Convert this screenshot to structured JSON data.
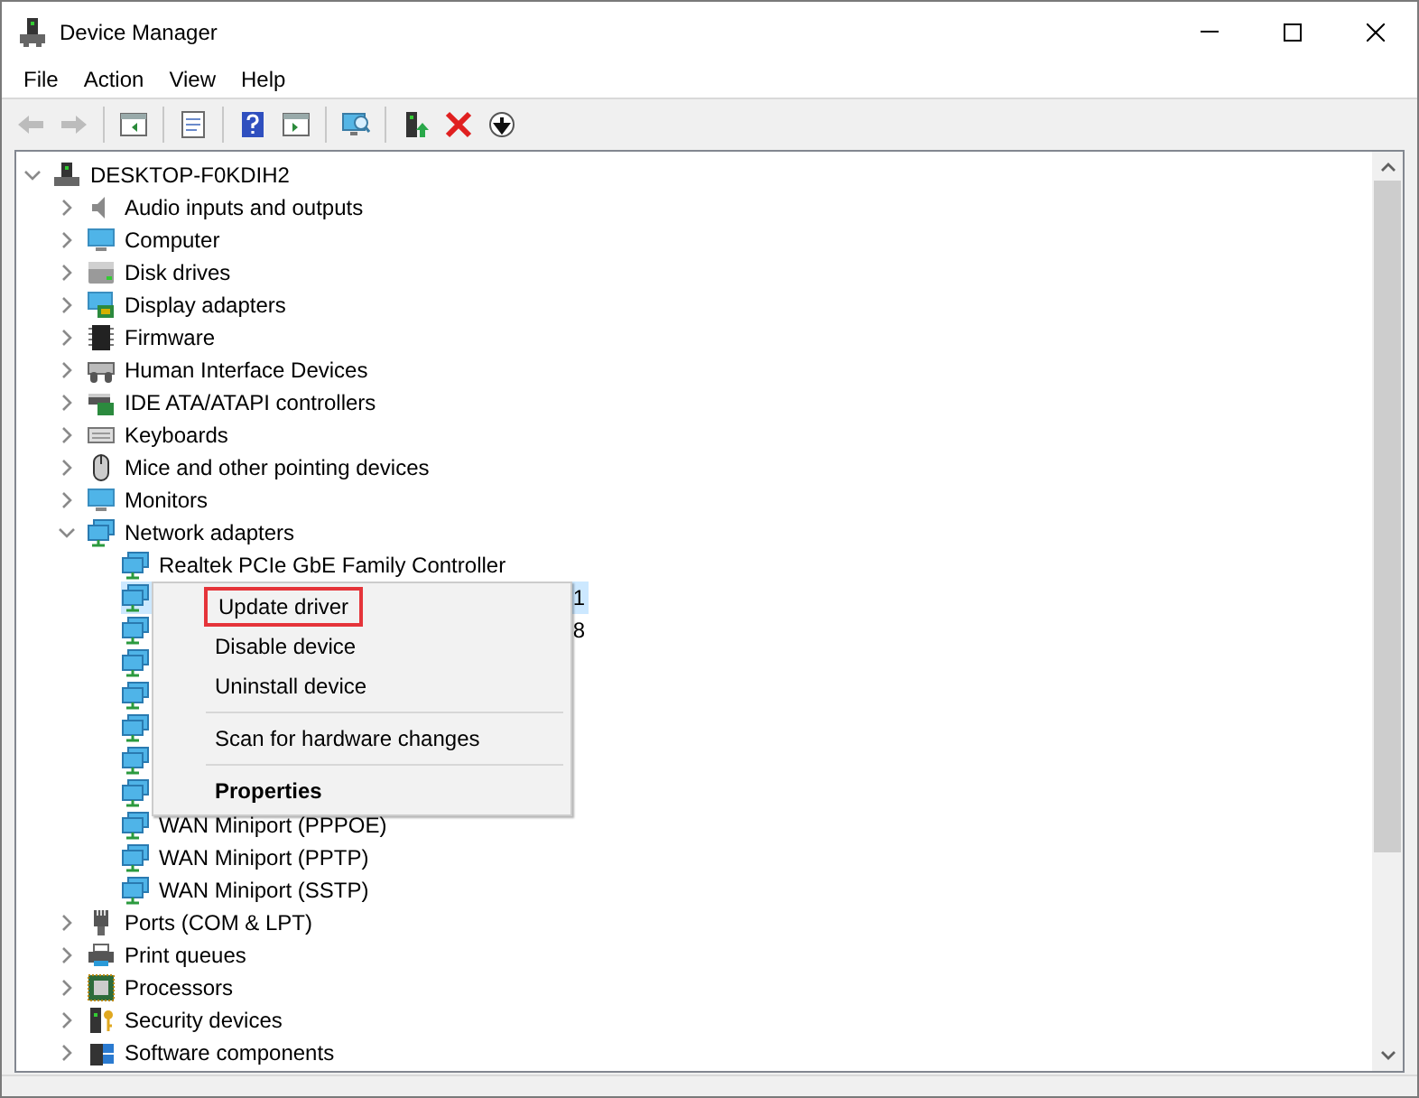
{
  "window": {
    "title": "Device Manager"
  },
  "menu": [
    "File",
    "Action",
    "View",
    "Help"
  ],
  "toolbar": [
    {
      "kind": "back",
      "disabled": true
    },
    {
      "kind": "forward",
      "disabled": true
    },
    {
      "kind": "separator"
    },
    {
      "kind": "tree",
      "disabled": false
    },
    {
      "kind": "separator"
    },
    {
      "kind": "properties",
      "disabled": false
    },
    {
      "kind": "separator"
    },
    {
      "kind": "help",
      "disabled": false
    },
    {
      "kind": "pane",
      "disabled": false
    },
    {
      "kind": "separator"
    },
    {
      "kind": "scan",
      "disabled": false
    },
    {
      "kind": "separator"
    },
    {
      "kind": "update",
      "disabled": false
    },
    {
      "kind": "uninstall",
      "disabled": false
    },
    {
      "kind": "disable",
      "disabled": false
    }
  ],
  "tree": {
    "label": "DESKTOP-F0KDIH2",
    "kind": "computer-root",
    "expanded": true,
    "children": [
      {
        "label": "Audio inputs and outputs",
        "kind": "audio",
        "expanded": false
      },
      {
        "label": "Computer",
        "kind": "monitor",
        "expanded": false
      },
      {
        "label": "Disk drives",
        "kind": "disk",
        "expanded": false
      },
      {
        "label": "Display adapters",
        "kind": "display",
        "expanded": false
      },
      {
        "label": "Firmware",
        "kind": "chip",
        "expanded": false
      },
      {
        "label": "Human Interface Devices",
        "kind": "hid",
        "expanded": false
      },
      {
        "label": "IDE ATA/ATAPI controllers",
        "kind": "ide",
        "expanded": false
      },
      {
        "label": "Keyboards",
        "kind": "keyboard",
        "expanded": false
      },
      {
        "label": "Mice and other pointing devices",
        "kind": "mouse",
        "expanded": false
      },
      {
        "label": "Monitors",
        "kind": "monitor",
        "expanded": false
      },
      {
        "label": "Network adapters",
        "kind": "network",
        "expanded": true,
        "children": [
          {
            "label": "Realtek PCIe GbE Family Controller",
            "kind": "network",
            "selected": false
          },
          {
            "label": "1",
            "kind": "network",
            "covered": true,
            "selected": true
          },
          {
            "label": "8",
            "kind": "network",
            "covered": true,
            "selected": false
          },
          {
            "kind": "network",
            "covered": true,
            "selected": false
          },
          {
            "kind": "network",
            "covered": true,
            "selected": false
          },
          {
            "kind": "network",
            "covered": true,
            "selected": false
          },
          {
            "kind": "network",
            "covered": true,
            "selected": false
          },
          {
            "kind": "network",
            "covered": true,
            "selected": false
          },
          {
            "label": "WAN Miniport (PPPOE)",
            "kind": "network",
            "selected": false
          },
          {
            "label": "WAN Miniport (PPTP)",
            "kind": "network",
            "selected": false
          },
          {
            "label": "WAN Miniport (SSTP)",
            "kind": "network",
            "selected": false
          }
        ]
      },
      {
        "label": "Ports (COM & LPT)",
        "kind": "port",
        "expanded": false
      },
      {
        "label": "Print queues",
        "kind": "printer",
        "expanded": false
      },
      {
        "label": "Processors",
        "kind": "cpu",
        "expanded": false
      },
      {
        "label": "Security devices",
        "kind": "security",
        "expanded": false
      },
      {
        "label": "Software components",
        "kind": "software",
        "expanded": false
      }
    ]
  },
  "context_menu": [
    {
      "kind": "item",
      "label": "Update driver",
      "bold": false,
      "highlighted": true
    },
    {
      "kind": "item",
      "label": "Disable device",
      "bold": false,
      "highlighted": false
    },
    {
      "kind": "item",
      "label": "Uninstall device",
      "bold": false,
      "highlighted": false
    },
    {
      "kind": "separator"
    },
    {
      "kind": "item",
      "label": "Scan for hardware changes",
      "bold": false,
      "highlighted": false
    },
    {
      "kind": "separator"
    },
    {
      "kind": "item",
      "label": "Properties",
      "bold": true,
      "highlighted": false
    }
  ]
}
